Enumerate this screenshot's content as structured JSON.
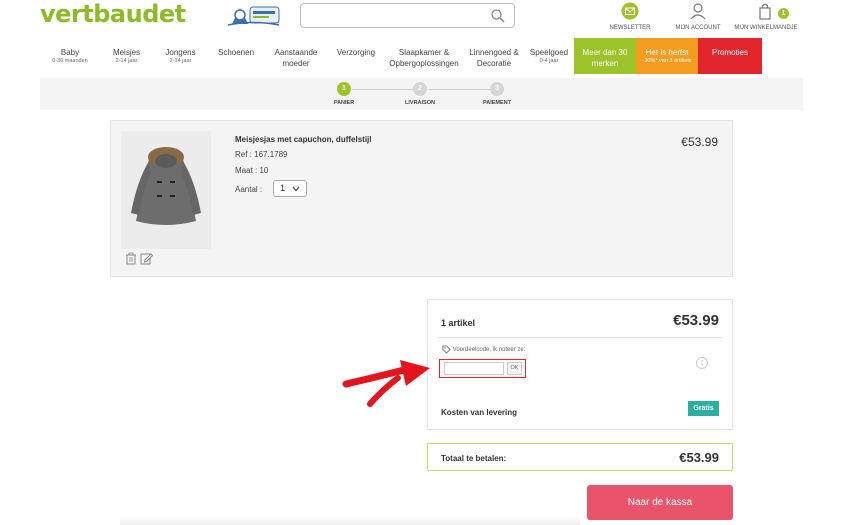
{
  "header": {
    "logo": "vertbaudet",
    "search_placeholder": "",
    "newsletter_label": "NEWSLETTER",
    "account_label": "MIJN ACCOUNT",
    "cart_label": "MIJN WINKELMANDJE",
    "cart_count": "1"
  },
  "nav": [
    {
      "label": "Baby",
      "sub": "0-36 maanden"
    },
    {
      "label": "Meisjes",
      "sub": "2-14 jaar"
    },
    {
      "label": "Jongens",
      "sub": "2-14 jaar"
    },
    {
      "label": "Schoenen",
      "sub": ""
    },
    {
      "label": "Aanstaande moeder",
      "sub": ""
    },
    {
      "label": "Verzorging",
      "sub": ""
    },
    {
      "label": "Slaapkamer & Opbergoplossingen",
      "sub": ""
    },
    {
      "label": "Linnengoed & Decoratie",
      "sub": ""
    },
    {
      "label": "Speelgoed",
      "sub": "0-4 jaar"
    },
    {
      "label": "Meer dan 30 merken",
      "sub": ""
    },
    {
      "label": "Het is herfst",
      "sub": "-30%* van 3 artikels"
    },
    {
      "label": "Promoties",
      "sub": ""
    }
  ],
  "steps": [
    {
      "num": "1",
      "label": "PANIER"
    },
    {
      "num": "2",
      "label": "LIVRAISON"
    },
    {
      "num": "3",
      "label": "PAIEMENT"
    }
  ],
  "product": {
    "title": "Meisjesjas met capuchon, duffelstijl",
    "ref": "Ref : 167.1789",
    "size": "Maat : 10",
    "qty_label": "Aantal :",
    "qty_value": "1",
    "price": "€53.99"
  },
  "summary": {
    "count": "1 artikel",
    "price": "€53.99",
    "promo_label": "Voordeelcode, ik noteer ze:",
    "promo_ok": "OK",
    "shipping_label": "Kosten van levering",
    "shipping_value": "Gratis"
  },
  "total": {
    "label": "Totaal te betalen:",
    "price": "€53.99"
  },
  "checkout_label": "Naar de kassa",
  "colors": {
    "brand_green": "#8dbb25",
    "promo_red": "#e3262e",
    "orange": "#f39c1f",
    "checkout_pink": "#e8546a",
    "gratis_teal": "#2ab0a0"
  }
}
